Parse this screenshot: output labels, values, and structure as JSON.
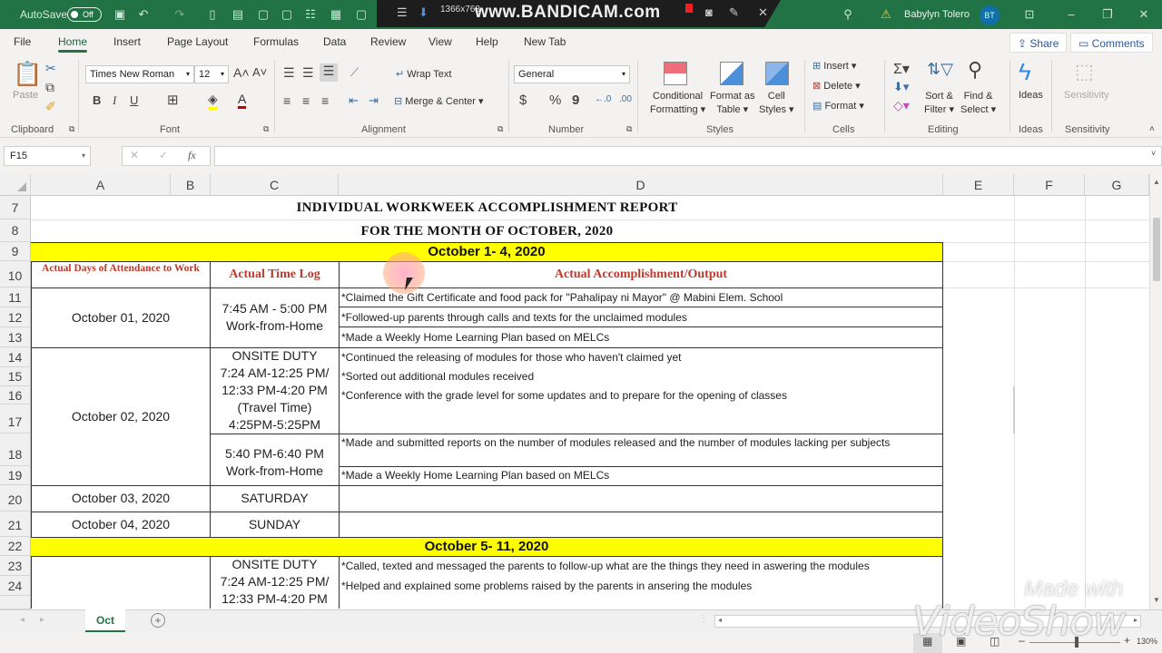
{
  "titlebar": {
    "autosave_label": "AutoSave",
    "autosave_state": "Off",
    "user_name": "Babylyn Tolero",
    "user_initials": "BT",
    "recorder_resolution": "1366x768",
    "recorder_brand": "www.BANDICAM.com"
  },
  "menu": {
    "tabs": [
      "File",
      "Home",
      "Insert",
      "Page Layout",
      "Formulas",
      "Data",
      "Review",
      "View",
      "Help",
      "New Tab"
    ],
    "active": "Home",
    "share": "Share",
    "comments": "Comments"
  },
  "ribbon": {
    "clipboard": {
      "label": "Clipboard",
      "paste": "Paste"
    },
    "font": {
      "label": "Font",
      "family": "Times New Roman",
      "size": "12",
      "bold": "B",
      "italic": "I",
      "underline": "U"
    },
    "alignment": {
      "label": "Alignment",
      "wrap_text": "Wrap Text",
      "merge_center": "Merge & Center"
    },
    "number": {
      "label": "Number",
      "format": "General",
      "currency": "$",
      "percent": "%",
      "comma": "9"
    },
    "styles": {
      "label": "Styles",
      "conditional": "Conditional",
      "conditional2": "Formatting",
      "format_table": "Format as",
      "format_table2": "Table",
      "cell_styles": "Cell",
      "cell_styles2": "Styles"
    },
    "cells": {
      "label": "Cells",
      "insert": "Insert",
      "delete": "Delete",
      "format": "Format"
    },
    "editing": {
      "label": "Editing",
      "sort": "Sort &",
      "sort2": "Filter",
      "find": "Find &",
      "find2": "Select"
    },
    "ideas": {
      "label": "Ideas",
      "button": "Ideas"
    },
    "sensitivity": {
      "label": "Sensitivity",
      "button": "Sensitivity"
    }
  },
  "formula_bar": {
    "name_box": "F15",
    "formula": ""
  },
  "columns": [
    "A",
    "B",
    "C",
    "D",
    "E",
    "F",
    "G"
  ],
  "rows": [
    "7",
    "8",
    "9",
    "10",
    "11",
    "12",
    "13",
    "14",
    "15",
    "16",
    "17",
    "18",
    "19",
    "20",
    "21",
    "22",
    "23",
    "24"
  ],
  "sheet": {
    "title": "INDIVIDUAL WORKWEEK ACCOMPLISHMENT REPORT",
    "subtitle": "FOR THE MONTH OF OCTOBER, 2020",
    "week1": "October 1- 4, 2020",
    "week2": "October 5- 11, 2020",
    "header_days": "Actual Days of Attendance to Work",
    "header_time": "Actual  Time Log",
    "header_output": "Actual Accomplishment/Output",
    "oct01": {
      "date": "October 01, 2020",
      "time": "7:45 AM - 5:00 PM\nWork-from-Home",
      "outputs": [
        "*Claimed the Gift Certificate and food pack for \"Pahalipay ni Mayor\" @ Mabini Elem. School",
        "*Followed-up parents through calls and texts for the unclaimed modules",
        "*Made a Weekly Home Learning Plan based on MELCs"
      ]
    },
    "oct02": {
      "date": "October 02, 2020",
      "time_onsite": "ONSITE DUTY\n7:24 AM-12:25 PM/\n12:33 PM-4:20 PM\n(Travel Time)\n4:25PM-5:25PM",
      "time_wfh": "5:40 PM-6:40 PM\nWork-from-Home",
      "outputs_onsite": [
        "*Continued the releasing of modules for those who haven't claimed yet",
        "*Sorted out additional modules received",
        "*Conference with the grade level for some updates and to prepare for the opening of classes"
      ],
      "outputs_wfh": [
        "*Made and submitted reports on the number of modules released and the number of modules lacking per subjects",
        "*Made a Weekly Home Learning Plan based on MELCs"
      ]
    },
    "oct03": {
      "date": "October 03, 2020",
      "time": "SATURDAY"
    },
    "oct04": {
      "date": "October 04, 2020",
      "time": "SUNDAY"
    },
    "oct05": {
      "time": "ONSITE DUTY\n7:24 AM-12:25 PM/\n12:33 PM-4:20 PM",
      "outputs": [
        "*Called, texted and messaged the parents to follow-up what are the things they need in aswering the modules",
        "*Helped and explained some problems raised by the parents in ansering the modules"
      ]
    }
  },
  "sheet_tabs": [
    "Oct"
  ],
  "status": {
    "zoom": "130%"
  },
  "watermark": {
    "line1": "Made with",
    "line2": "VideoShow"
  }
}
